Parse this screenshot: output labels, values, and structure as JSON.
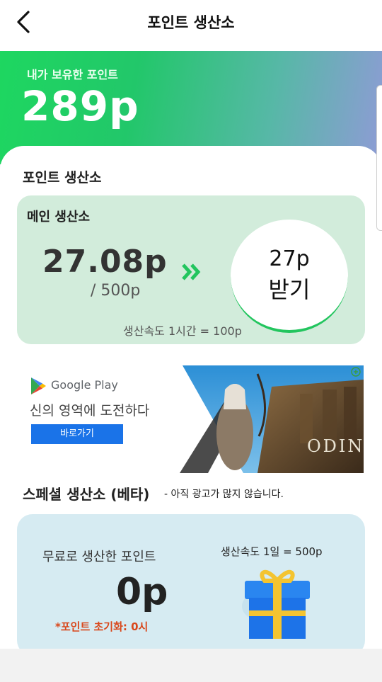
{
  "header": {
    "title": "포인트 생산소"
  },
  "wallet": {
    "label": "내가 보유한 포인트",
    "amount": "289p"
  },
  "producer": {
    "section_title": "포인트 생산소",
    "main": {
      "title": "메인 생산소",
      "current": "27.08p",
      "capacity": "/ 500p",
      "claim_line1": "27p",
      "claim_line2": "받기",
      "speed": "생산속도 1시간 = 100p"
    }
  },
  "ad": {
    "brand": "Google Play",
    "headline": "신의 영역에 도전하다",
    "cta": "바로가기",
    "art_text": "ODIN"
  },
  "special": {
    "title": "스페셜 생산소 (베타)",
    "note": "- 아직 광고가 많지 않습니다.",
    "free_label": "무료로 생산한 포인트",
    "free_amount": "0p",
    "reset_text": "*포인트 초기화: 0시",
    "speed": "생산속도 1일 = 500p"
  },
  "colors": {
    "accent_green": "#22c55e",
    "card_green": "#d2ecdb",
    "card_blue": "#d6ebf2",
    "gift_blue": "#1d73e8",
    "ribbon": "#f4c430"
  }
}
